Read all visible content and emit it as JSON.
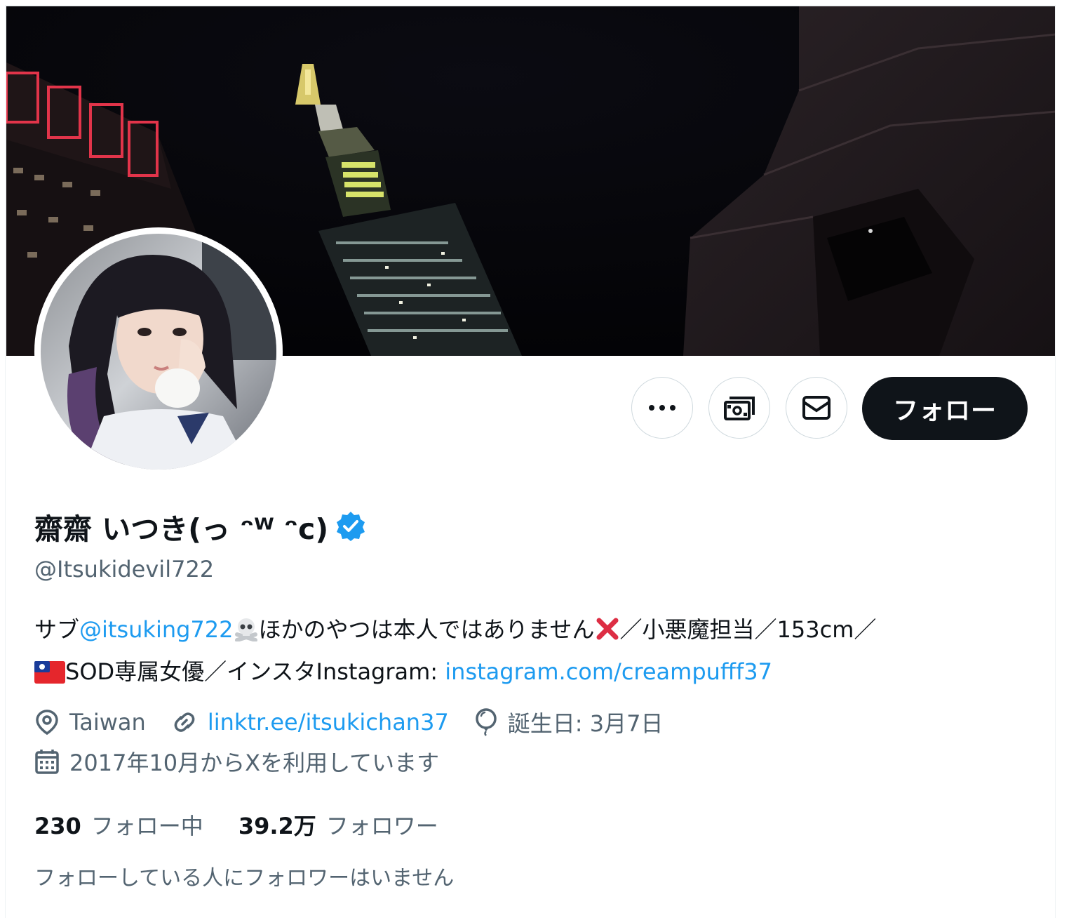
{
  "profile": {
    "display_name": "齋齋 いつき(っ ᵔᵂ ᵔc)",
    "handle": "@Itsukidevil722",
    "verified": true,
    "banner_alt": "night skyline banner",
    "avatar_alt": "profile photo"
  },
  "actions": {
    "more_icon": "more-horizontal-icon",
    "subscribe_icon": "money-icon",
    "message_icon": "envelope-icon",
    "follow_label": "フォロー"
  },
  "bio": {
    "prefix": "サブ",
    "mention": "@itsuking722",
    "skull_emoji": "☠️",
    "part1": "ほかのやつは本人ではありません",
    "cross_emoji": "❌",
    "part2": "／小悪魔担当／153cm／",
    "flag_emoji": "taiwan-flag",
    "part3": "SOD専属女優／インスタInstagram: ",
    "link": "instagram.com/creampufff37"
  },
  "meta": {
    "location": "Taiwan",
    "website": "linktr.ee/itsukichan37",
    "birthday": "誕生日: 3月7日",
    "joined": "2017年10月からXを利用しています"
  },
  "stats": {
    "following_count": "230",
    "following_label": "フォロー中",
    "followers_count": "39.2万",
    "followers_label": "フォロワー"
  },
  "followed_by_note": "フォローしている人にフォロワーはいません",
  "colors": {
    "accent": "#1d9bf0",
    "text_primary": "#0f1419",
    "text_secondary": "#536471",
    "follow_button_bg": "#0f1419",
    "verified_badge": "#1d9bf0"
  }
}
